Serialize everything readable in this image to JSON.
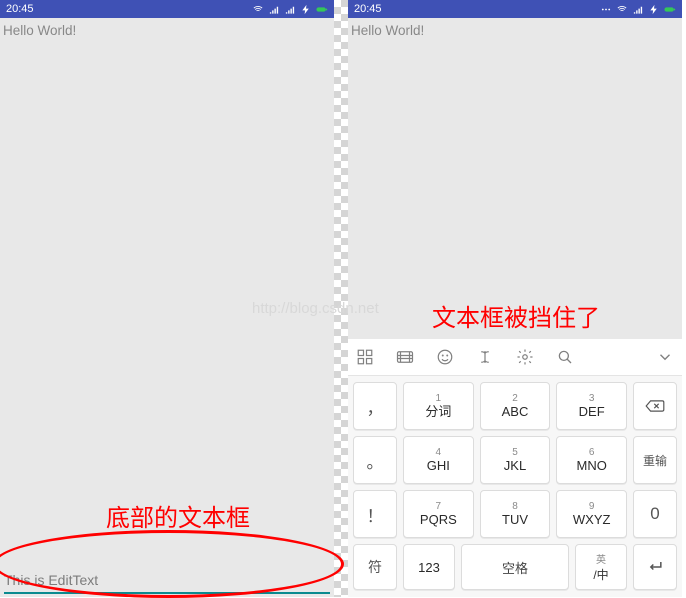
{
  "status": {
    "time": "20:45"
  },
  "content": {
    "hello": "Hello World!",
    "edit_value": "This is EditText"
  },
  "annotations": {
    "bottom_text_box": "底部的文本框",
    "covered": "文本框被挡住了"
  },
  "watermark": "http://blog.csdn.net",
  "ime": {
    "row1": [
      {
        "digit": "1",
        "label": "分词"
      },
      {
        "digit": "2",
        "label": "ABC"
      },
      {
        "digit": "3",
        "label": "DEF"
      }
    ],
    "row2": [
      {
        "digit": "4",
        "label": "GHI"
      },
      {
        "digit": "5",
        "label": "JKL"
      },
      {
        "digit": "6",
        "label": "MNO"
      }
    ],
    "row3": [
      {
        "digit": "7",
        "label": "PQRS"
      },
      {
        "digit": "8",
        "label": "TUV"
      },
      {
        "digit": "9",
        "label": "WXYZ"
      }
    ],
    "side_left": {
      "r1": "，",
      "r2": "。",
      "r3": "！"
    },
    "side_right": {
      "r2": "重输",
      "r3": "0"
    },
    "row4": {
      "sym": "符",
      "num": "123",
      "space": "空格",
      "lang_top": "英",
      "lang_bot": "/中"
    },
    "backspace_icon": "backspace-icon"
  }
}
